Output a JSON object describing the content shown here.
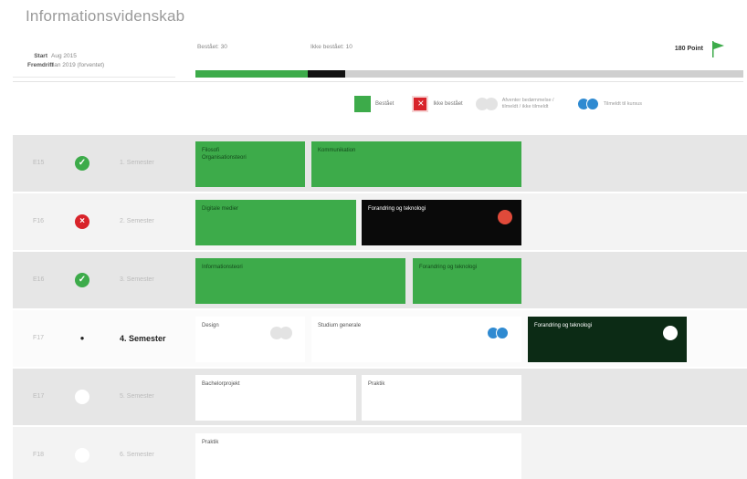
{
  "title": "Informationsvidenskab",
  "info": {
    "start_key": "Start",
    "start_val": "Aug 2015",
    "fremdrift_key": "Fremdrift",
    "fremdrift_val": "Jan 2019 (forventet)"
  },
  "progress": {
    "passed_label": "Bestået: 30",
    "failed_label": "Ikke bestået: 10",
    "goal_label": "180 Point",
    "passed_fraction": 0.205,
    "failed_fraction": 0.068
  },
  "legend": {
    "passed": "Bestået",
    "failed": "Ikke bestået",
    "grey_text": "Afventer bedømmelse / tilmeldt / ikke tilmeldt",
    "blue_text": "Tilmeldt til kursus"
  },
  "colors": {
    "passed": "#3dab4a",
    "failed": "#d8232a",
    "dark": "#0a0a0a",
    "blue": "#2f8ad1"
  },
  "semesters": [
    {
      "code": "E15",
      "name": "1. Semester",
      "status": "passed",
      "status_icon": "check-icon"
    },
    {
      "code": "F16",
      "name": "2. Semester",
      "status": "failed",
      "status_icon": "x-icon"
    },
    {
      "code": "E16",
      "name": "3. Semester",
      "status": "passed",
      "status_icon": "check-icon"
    },
    {
      "code": "F17",
      "name": "4. Semester",
      "status": "current",
      "status_icon": "bullet-icon"
    },
    {
      "code": "E17",
      "name": "5. Semester",
      "status": "future",
      "status_icon": "circle-icon"
    },
    {
      "code": "F18",
      "name": "6. Semester",
      "status": "future",
      "status_icon": "circle-icon"
    }
  ],
  "courses": {
    "s1_a": "Filosofi\nOrganisationsteori",
    "s1_b": "Kommunikation",
    "s2_a": "Digitale medier",
    "s2_b": "Forandring og teknologi",
    "s3_a": "Informationsteori",
    "s3_b": "Forandring og teknologi",
    "s4_a": "Design",
    "s4_b": "Studium generale",
    "s4_c": "Forandring og teknologi",
    "s5_a": "Bachelorprojekt",
    "s5_b": "Praktik",
    "s6_a": "Praktik"
  }
}
